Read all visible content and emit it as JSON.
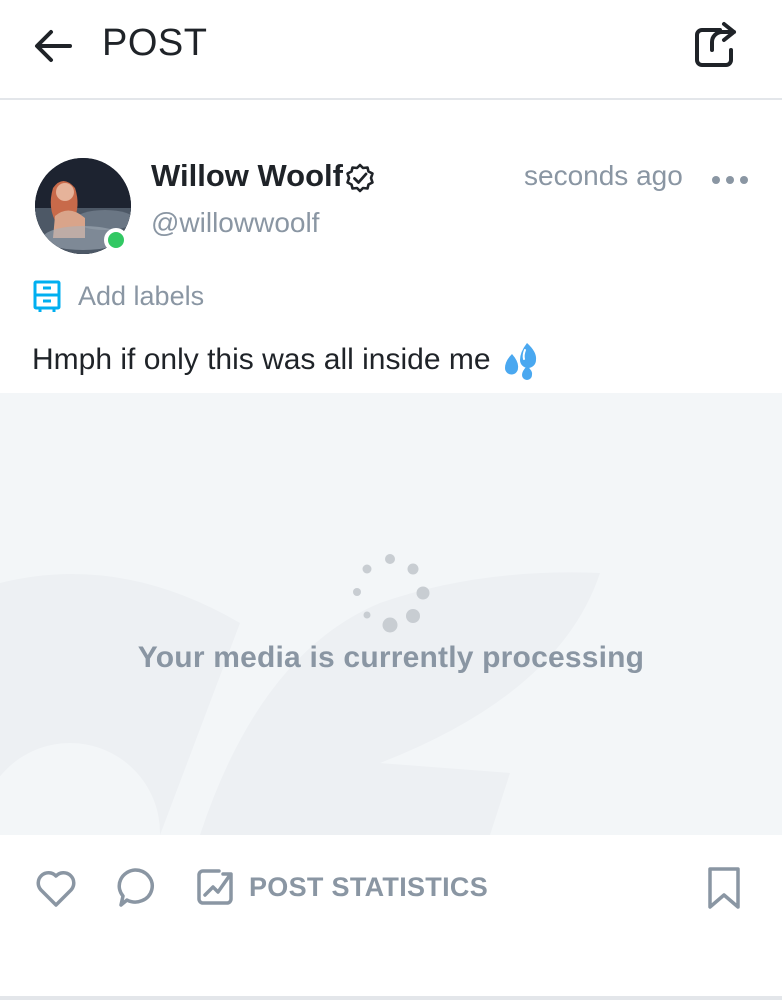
{
  "header": {
    "title": "POST",
    "back_icon": "arrow-left-icon",
    "share_icon": "share-icon"
  },
  "post": {
    "author": {
      "name": "Willow Woolf",
      "handle": "@willowwoolf",
      "verified": true,
      "online": true,
      "online_color": "#32c863"
    },
    "time": "seconds ago",
    "more_icon": "more-dots-icon",
    "labels": {
      "label": "Add labels",
      "icon": "label-icon",
      "color": "#00aff0"
    },
    "text": "Hmph if only this was all inside me",
    "emoji": "sweat-droplets-icon"
  },
  "media": {
    "status_text": "Your media is currently processing",
    "spinner_icon": "loading-spinner-icon"
  },
  "footer": {
    "like_icon": "heart-icon",
    "comment_icon": "comment-icon",
    "stats_label": "POST STATISTICS",
    "stats_icon": "statistics-icon",
    "bookmark_icon": "bookmark-icon"
  },
  "colors": {
    "muted_text": "#8a96a3",
    "primary_text": "#1f2328",
    "accent": "#00aff0",
    "media_bg": "#f3f6f8"
  }
}
